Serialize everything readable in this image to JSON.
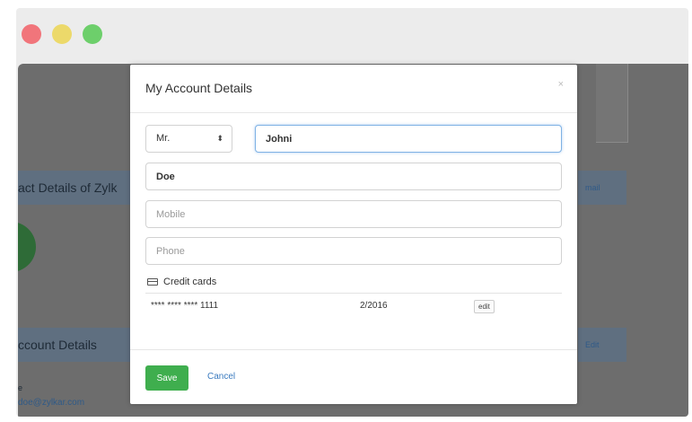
{
  "window": {
    "colors": {
      "close": "#f1757b",
      "minimize": "#ecd96a",
      "zoom": "#6dcf6b"
    }
  },
  "background": {
    "contact_strip_label": "act Details of Zylk",
    "contact_strip_action": "mail",
    "account_strip_label": "ccount Details",
    "account_strip_action": "Edit",
    "name_fragment": "e",
    "email_fragment": "doe@zylkar.com"
  },
  "modal": {
    "title": "My Account Details",
    "close_glyph": "×",
    "salutation": {
      "value": "Mr.",
      "arrow": "⬍"
    },
    "first_name": {
      "value": "Johni"
    },
    "last_name": {
      "value": "Doe"
    },
    "mobile": {
      "placeholder": "Mobile"
    },
    "phone": {
      "placeholder": "Phone"
    },
    "credit_cards": {
      "heading": "Credit cards",
      "rows": [
        {
          "number": "**** **** **** 1111",
          "expiry": "2/2016",
          "edit_label": "edit"
        }
      ]
    },
    "footer": {
      "save_label": "Save",
      "cancel_label": "Cancel",
      "save_color": "#3fae4e"
    }
  }
}
